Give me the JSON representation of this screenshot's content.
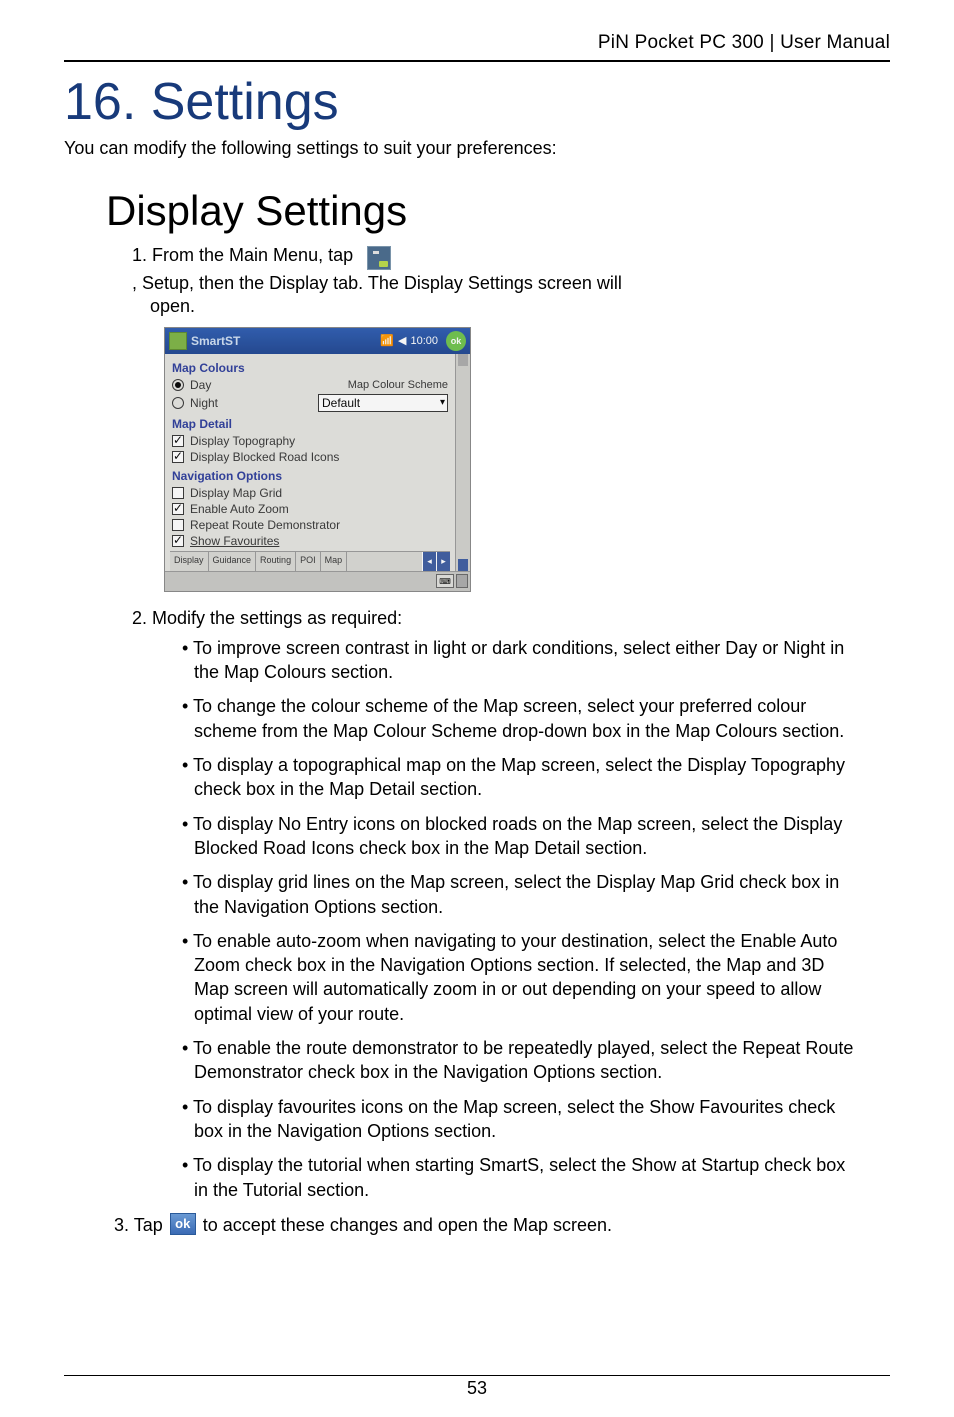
{
  "header": {
    "product": "PiN Pocket PC 300",
    "doc": "User Manual"
  },
  "chapter": {
    "title": "16. Settings"
  },
  "intro": "You can modify the following settings to suit your preferences:",
  "section": {
    "title": "Display Settings"
  },
  "step1": {
    "prefix": "1. From the Main Menu, tap",
    "mid": ", Setup, then the Display tab. The Display Settings screen will",
    "cont": "open."
  },
  "screenshot": {
    "appTitle": "SmartST",
    "time": "10:00",
    "okLabel": "ok",
    "sections": {
      "mapColours": {
        "heading": "Map Colours",
        "dayLabel": "Day",
        "nightLabel": "Night",
        "schemeLabel": "Map Colour Scheme",
        "schemeValue": "Default"
      },
      "mapDetail": {
        "heading": "Map Detail",
        "topography": "Display Topography",
        "blockedIcons": "Display Blocked Road Icons"
      },
      "navOptions": {
        "heading": "Navigation Options",
        "grid": "Display Map Grid",
        "autoZoom": "Enable Auto Zoom",
        "repeat": "Repeat Route Demonstrator",
        "showFav": "Show Favourites"
      }
    },
    "tabs": [
      "Display",
      "Guidance",
      "Routing",
      "POI",
      "Map"
    ]
  },
  "step2_title": "2. Modify the settings as required:",
  "bullets": [
    "• To improve screen contrast in light or dark conditions, select either Day or Night in the Map Colours section.",
    "• To change the colour scheme of the Map screen, select your preferred colour scheme from the Map Colour Scheme drop-down box in the Map Colours section.",
    "• To display a topographical map on the Map screen, select the Display Topography check box in the Map Detail section.",
    "• To display No Entry icons on blocked roads on the Map screen, select the Display Blocked Road Icons check box in the Map Detail section.",
    "• To display grid lines on the Map screen, select the Display Map Grid check box in the Navigation Options section.",
    "• To enable auto-zoom when navigating to your destination, select the Enable Auto Zoom check box in the Navigation Options section. If selected, the Map and 3D Map screen will automatically zoom in or out depending on your speed to allow optimal view of your route.",
    "• To enable the route demonstrator to be repeatedly played, select the Repeat Route Demonstrator check box in the Navigation Options section.",
    "• To display favourites icons on the Map screen, select the Show Favourites check box in the Navigation Options section.",
    "• To display the tutorial when starting SmartS, select the Show at Startup check box in the Tutorial section."
  ],
  "step3": {
    "prefix": "3.  Tap",
    "suffix": " to accept these changes and open the Map screen.",
    "okText": "ok"
  },
  "pageNumber": "53"
}
